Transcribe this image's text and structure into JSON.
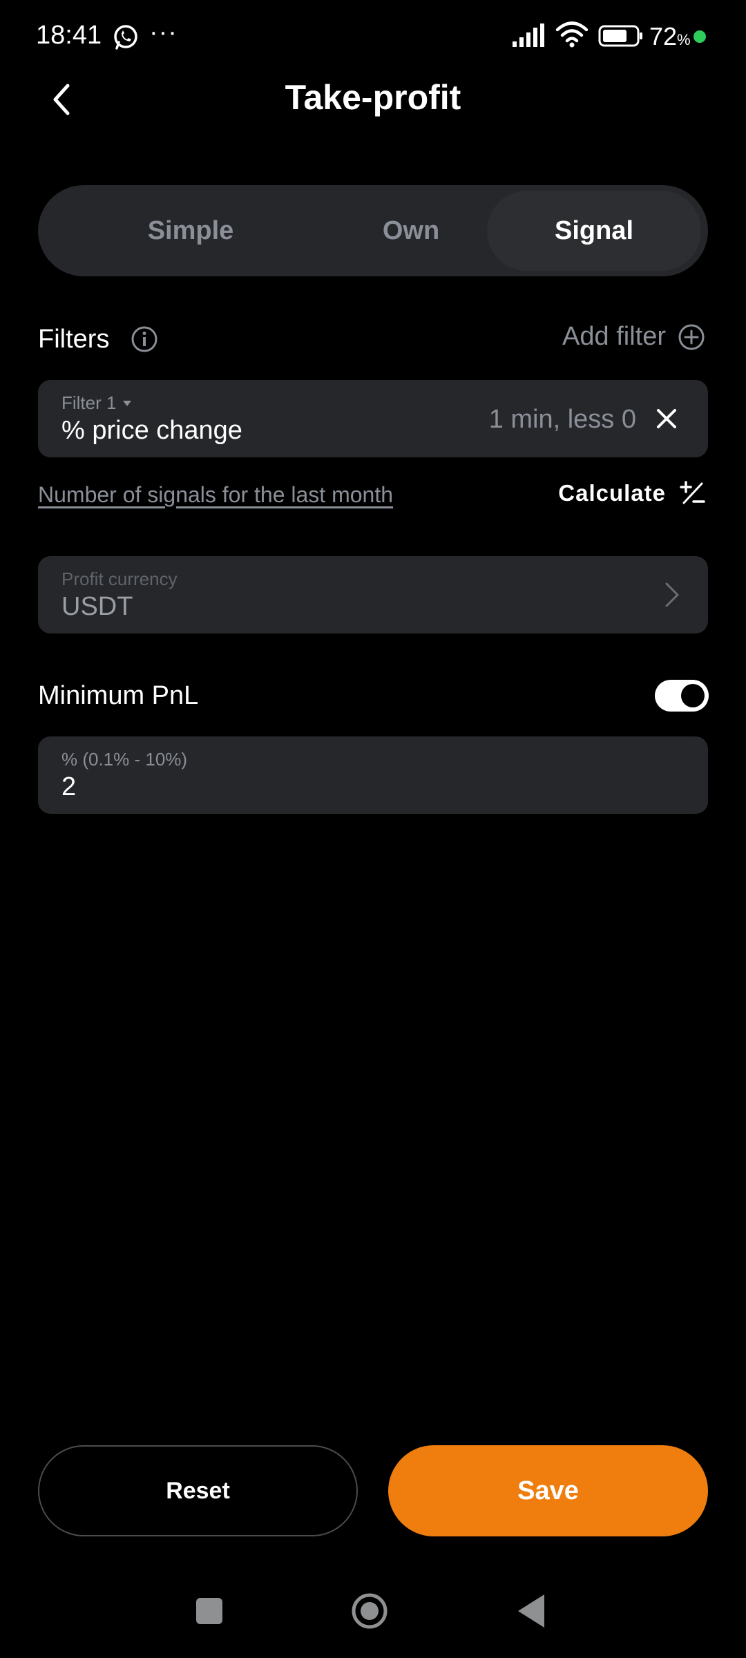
{
  "status_bar": {
    "time": "18:41",
    "more": "···",
    "battery_percent": "72",
    "battery_unit": "%",
    "dot_color": "#2ecc5a"
  },
  "header": {
    "title": "Take-profit",
    "back_icon": "chevron-left-icon"
  },
  "tabs": [
    {
      "label": "Simple",
      "active": false
    },
    {
      "label": "Own",
      "active": false
    },
    {
      "label": "Signal",
      "active": true
    }
  ],
  "filters": {
    "label": "Filters",
    "add_label": "Add filter",
    "items": [
      {
        "name_label": "Filter 1",
        "value": "% price change",
        "summary": "1 min, less 0"
      }
    ]
  },
  "signals": {
    "link_text": "Number of signals for the last month",
    "calculate_label": "Calculate"
  },
  "profit_currency": {
    "label": "Profit currency",
    "value": "USDT"
  },
  "minimum_pnl": {
    "label": "Minimum PnL",
    "enabled": true,
    "field_label": "% (0.1% - 10%)",
    "field_value": "2"
  },
  "actions": {
    "reset_label": "Reset",
    "save_label": "Save",
    "save_color": "#ef7e0e"
  }
}
